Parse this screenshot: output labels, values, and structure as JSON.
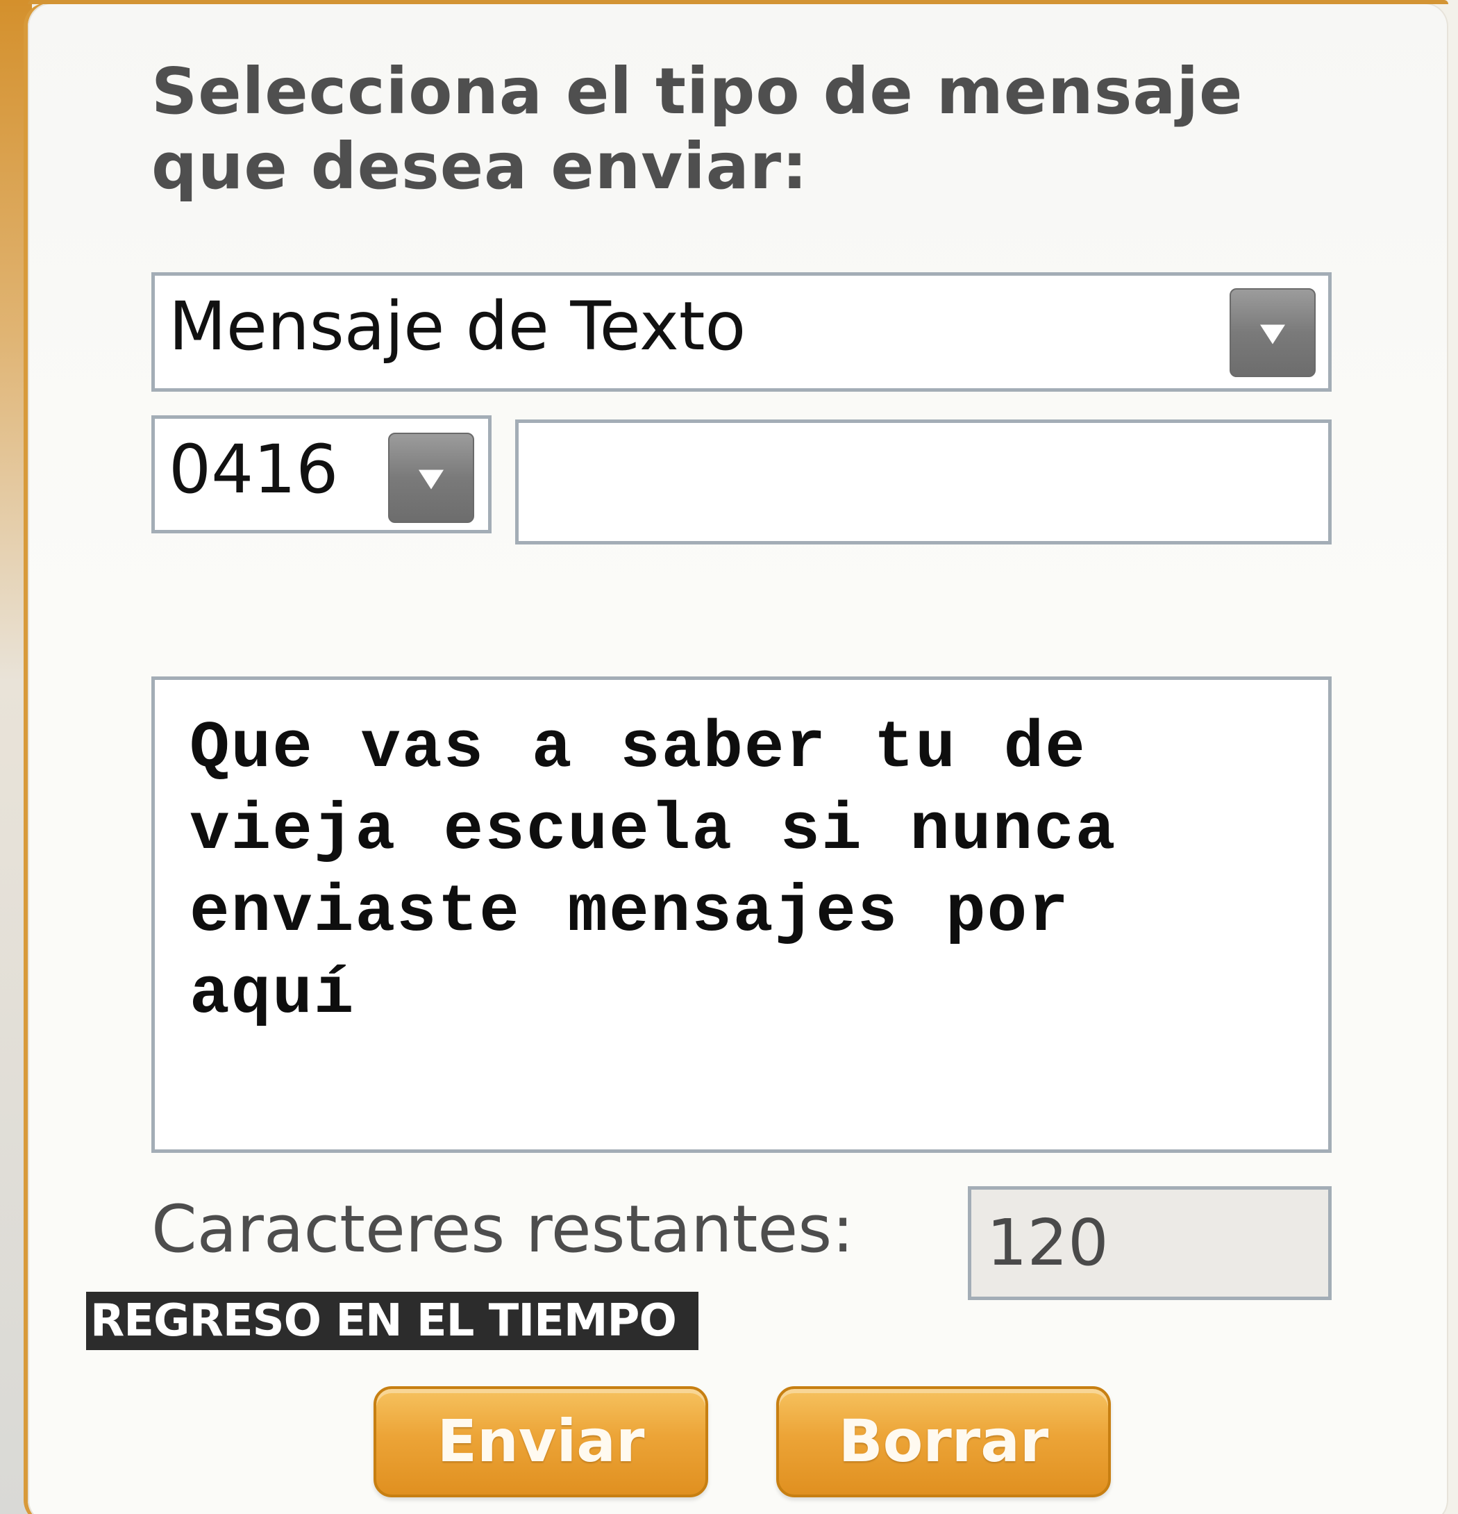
{
  "form": {
    "heading": "Selecciona el tipo de mensaje que desea enviar:",
    "message_type_select": {
      "selected": "Mensaje de Texto"
    },
    "area_code_select": {
      "selected": "0416"
    },
    "phone_input": {
      "value": "",
      "placeholder": ""
    },
    "message_textarea": {
      "value": "Que vas a saber tu de vieja escuela si nunca enviaste mensajes por aquí"
    },
    "remaining_chars": {
      "label": "Caracteres restantes:",
      "value": "120"
    },
    "watermark": "REGRESO EN EL TIEMPO",
    "buttons": {
      "send_label": "Enviar",
      "clear_label": "Borrar"
    }
  },
  "colors": {
    "accent": "#eca437",
    "border": "#a3adb6",
    "heading_text": "#4f4f4f",
    "panel_background": "#fbfbf8"
  },
  "icons": {
    "dropdown": "chevron-down-icon"
  }
}
